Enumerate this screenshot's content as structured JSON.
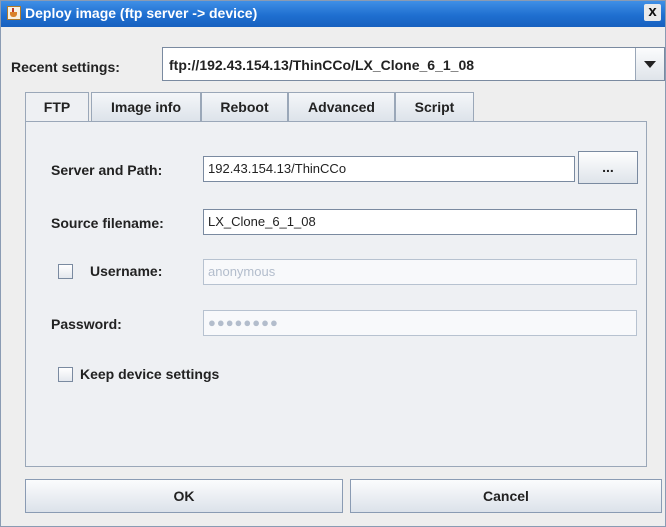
{
  "window": {
    "title": "Deploy image (ftp server -> device)",
    "close_glyph": "x",
    "icon": "java-cup-icon"
  },
  "recent": {
    "label": "Recent settings:",
    "value": "ftp://192.43.154.13/ThinCCo/LX_Clone_6_1_08"
  },
  "tabs": [
    {
      "label": "FTP",
      "active": true
    },
    {
      "label": "Image info",
      "active": false
    },
    {
      "label": "Reboot",
      "active": false
    },
    {
      "label": "Advanced",
      "active": false
    },
    {
      "label": "Script",
      "active": false
    }
  ],
  "ftp": {
    "server_label": "Server and Path:",
    "server_value": "192.43.154.13/ThinCCo",
    "browse_label": "...",
    "source_label": "Source filename:",
    "source_value": "LX_Clone_6_1_08",
    "username_label": "Username:",
    "username_value": "anonymous",
    "username_checked": false,
    "password_label": "Password:",
    "password_value": "●●●●●●●●",
    "keep_label": "Keep device settings",
    "keep_checked": false
  },
  "buttons": {
    "ok": "OK",
    "cancel": "Cancel"
  }
}
